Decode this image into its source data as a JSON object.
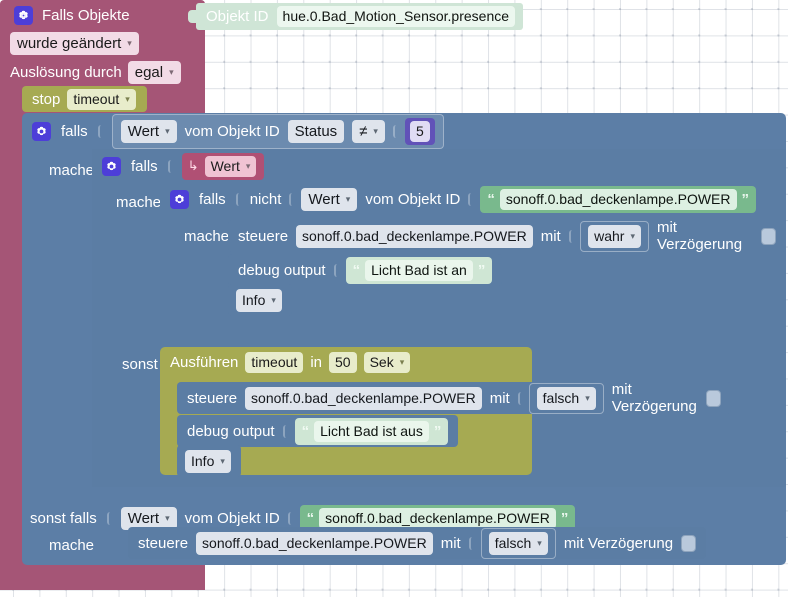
{
  "app": {
    "kind": "blockly-script-editor",
    "language": "de"
  },
  "colors": {
    "trigger_maroon": "#a55576",
    "control_blue": "#5b7da4",
    "timeout_olive": "#a6aa52",
    "objectid_mint": "#cfe5d6",
    "string_green": "#79b98d",
    "string_pale_green": "#cfe6d4",
    "variable_pink": "#b05074",
    "number_purple": "#6152b8",
    "gear_indigo": "#4d3ed8",
    "canvas_white": "#ffffff"
  },
  "trigger": {
    "title": "Falls Objekte",
    "mode": "wurde geändert",
    "trigger_by_label": "Auslösung durch",
    "trigger_by_value": "egal",
    "object_id_label": "Objekt ID",
    "object_id_value": "hue.0.Bad_Motion_Sensor.presence",
    "stop_label": "stop",
    "stop_value": "timeout"
  },
  "if1": {
    "keyword": "falls",
    "do_label": "mache",
    "else_if_label": "sonst falls",
    "else_if_do_label": "mache",
    "condition": {
      "value_dropdown": "Wert",
      "from_object_label": "vom Objekt ID",
      "object_field": "Status",
      "operator": "≠",
      "number": "5"
    },
    "else_if_condition": {
      "value_dropdown": "Wert",
      "from_object_label": "vom Objekt ID",
      "string": "sonoff.0.bad_deckenlampe.POWER"
    },
    "else_if_action": {
      "verb": "steuere",
      "target": "sonoff.0.bad_deckenlampe.POWER",
      "with_label": "mit",
      "value": "falsch",
      "delay_label": "mit Verzögerung"
    }
  },
  "if2": {
    "keyword": "falls",
    "do_label": "mache",
    "else_label": "sonst",
    "condition_variable": "Wert"
  },
  "if3": {
    "keyword": "falls",
    "do_label": "mache",
    "condition": {
      "negation": "nicht",
      "value_dropdown": "Wert",
      "from_object_label": "vom Objekt ID",
      "string": "sonoff.0.bad_deckenlampe.POWER"
    },
    "action": {
      "verb": "steuere",
      "target": "sonoff.0.bad_deckenlampe.POWER",
      "with_label": "mit",
      "value": "wahr",
      "delay_label": "mit Verzögerung"
    },
    "debug": {
      "label": "debug output",
      "text": "Licht Bad ist an",
      "level": "Info"
    }
  },
  "exec_timeout": {
    "verb": "Ausführen",
    "name": "timeout",
    "in_label": "in",
    "delay": "50",
    "unit": "Sek",
    "action": {
      "verb": "steuere",
      "target": "sonoff.0.bad_deckenlampe.POWER",
      "with_label": "mit",
      "value": "falsch",
      "delay_label": "mit Verzögerung"
    },
    "debug": {
      "label": "debug output",
      "text": "Licht Bad ist aus",
      "level": "Info"
    }
  },
  "glyphs": {
    "quote_open": "“",
    "quote_close": "”",
    "arrow_var": "↳",
    "caret_down": "▾"
  }
}
